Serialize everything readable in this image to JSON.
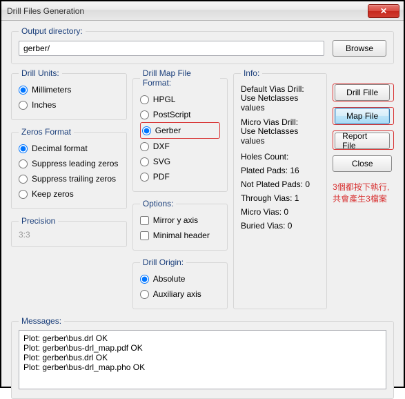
{
  "window": {
    "title": "Drill Files Generation"
  },
  "output": {
    "label": "Output directory:",
    "value": "gerber/",
    "browse": "Browse"
  },
  "units": {
    "legend": "Drill Units:",
    "options": [
      "Millimeters",
      "Inches"
    ],
    "selected": 0
  },
  "zeros": {
    "legend": "Zeros Format",
    "options": [
      "Decimal format",
      "Suppress leading zeros",
      "Suppress trailing zeros",
      "Keep zeros"
    ],
    "selected": 0
  },
  "precision": {
    "legend": "Precision",
    "value": "3:3"
  },
  "mapformat": {
    "legend": "Drill Map File Format:",
    "options": [
      "HPGL",
      "PostScript",
      "Gerber",
      "DXF",
      "SVG",
      "PDF"
    ],
    "selected": 2
  },
  "options": {
    "legend": "Options:",
    "items": [
      "Mirror y axis",
      "Minimal header"
    ]
  },
  "origin": {
    "legend": "Drill Origin:",
    "options": [
      "Absolute",
      "Auxiliary axis"
    ],
    "selected": 0
  },
  "info": {
    "legend": "Info:",
    "default_label": "Default Vias Drill:",
    "default_value": "Use Netclasses values",
    "micro_label": "Micro Vias Drill:",
    "micro_value": "Use Netclasses values",
    "holes_label": "Holes Count:",
    "holes": [
      "Plated Pads: 16",
      "Not Plated Pads: 0",
      "Through Vias: 1",
      "Micro Vias: 0",
      "Buried Vias: 0"
    ]
  },
  "buttons": {
    "drill": "Drill Fille",
    "map": "Map File",
    "report": "Report File",
    "close": "Close"
  },
  "annotation": {
    "line1": "3個都按下執行,",
    "line2": "共會產生3檔案"
  },
  "messages": {
    "legend": "Messages:",
    "text": "Plot: gerber\\bus.drl OK\nPlot: gerber\\bus-drl_map.pdf OK\nPlot: gerber\\bus.drl OK\nPlot: gerber\\bus-drl_map.pho OK"
  }
}
